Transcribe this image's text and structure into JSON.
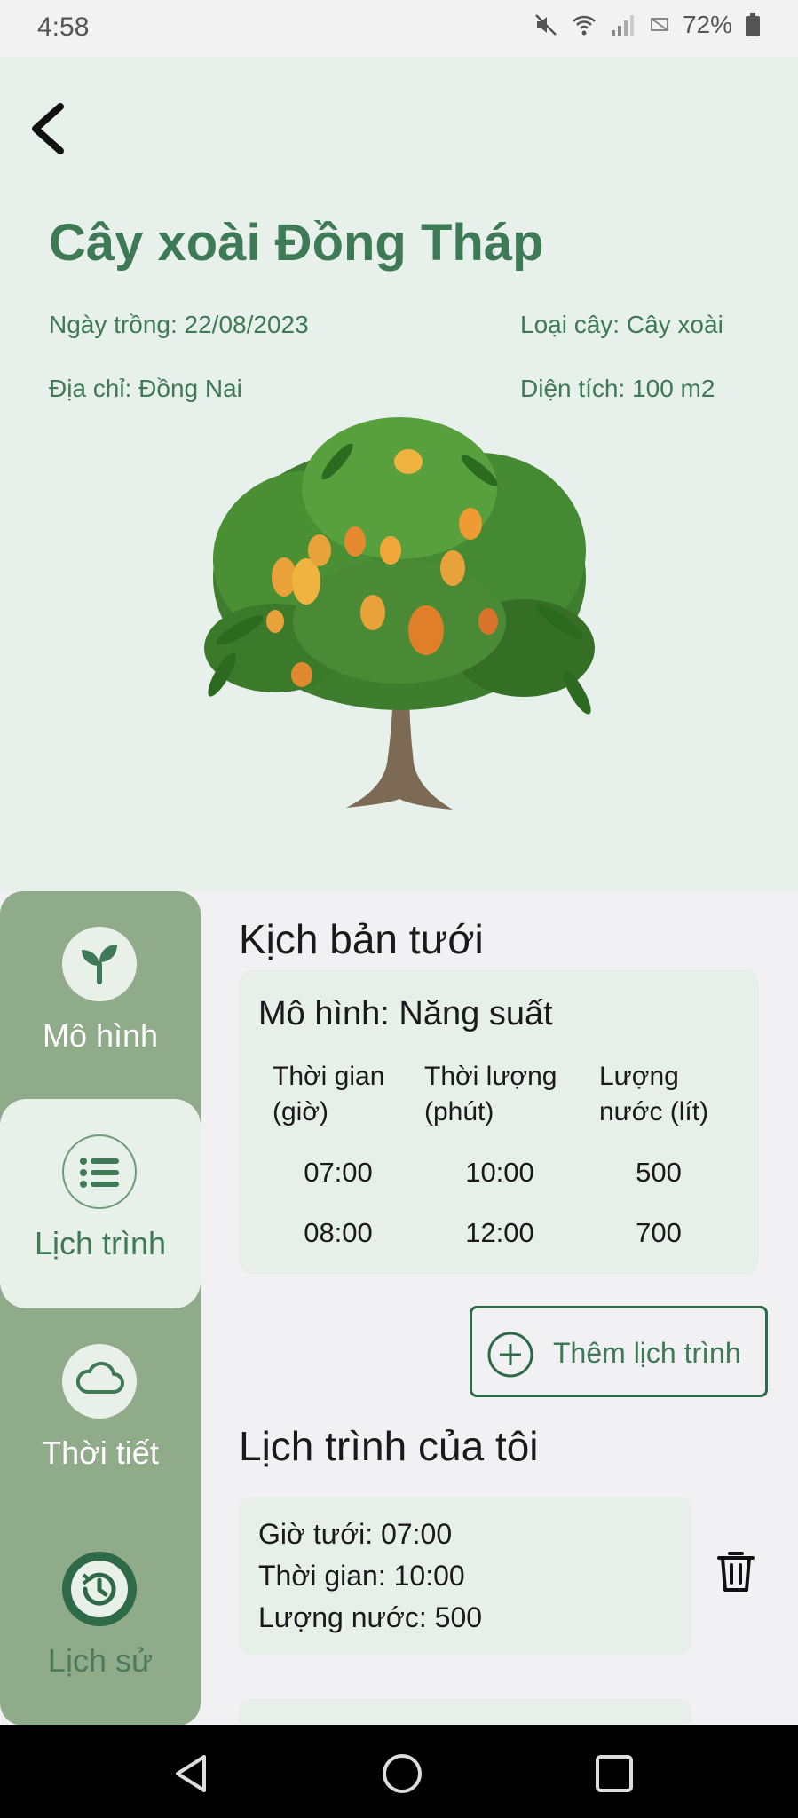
{
  "status_bar": {
    "time": "4:58",
    "battery": "72%"
  },
  "header": {
    "title": "Cây xoài Đồng Tháp",
    "planting_date": "Ngày trồng: 22/08/2023",
    "plant_type": "Loại cây: Cây xoài",
    "address": "Địa chỉ: Đồng Nai",
    "area": "Diện tích: 100 m2"
  },
  "sidebar": {
    "items": [
      {
        "label": "Mô hình",
        "icon": "sprout-icon"
      },
      {
        "label": "Lịch trình",
        "icon": "list-icon",
        "active": true
      },
      {
        "label": "Thời tiết",
        "icon": "cloud-icon"
      },
      {
        "label": "Lịch sử",
        "icon": "history-icon"
      }
    ]
  },
  "irrigation": {
    "section_title": "Kịch bản tưới",
    "model": "Mô hình: Năng suất",
    "columns": [
      "Thời gian\n(giờ)",
      "Thời lượng\n(phút)",
      "Lượng\nnước (lít)"
    ],
    "rows": [
      [
        "07:00",
        "10:00",
        "500"
      ],
      [
        "08:00",
        "12:00",
        "700"
      ]
    ]
  },
  "add_schedule_label": "Thêm lịch trình",
  "my_schedules": {
    "section_title": "Lịch trình của tôi",
    "items": [
      {
        "time": "Giờ tưới: 07:00",
        "duration": "Thời gian: 10:00",
        "water": "Lượng nước: 500"
      }
    ]
  },
  "colors": {
    "brand_green": "#3f7a57",
    "sidebar": "#8fab89",
    "header_bg": "#e7f0ea"
  }
}
